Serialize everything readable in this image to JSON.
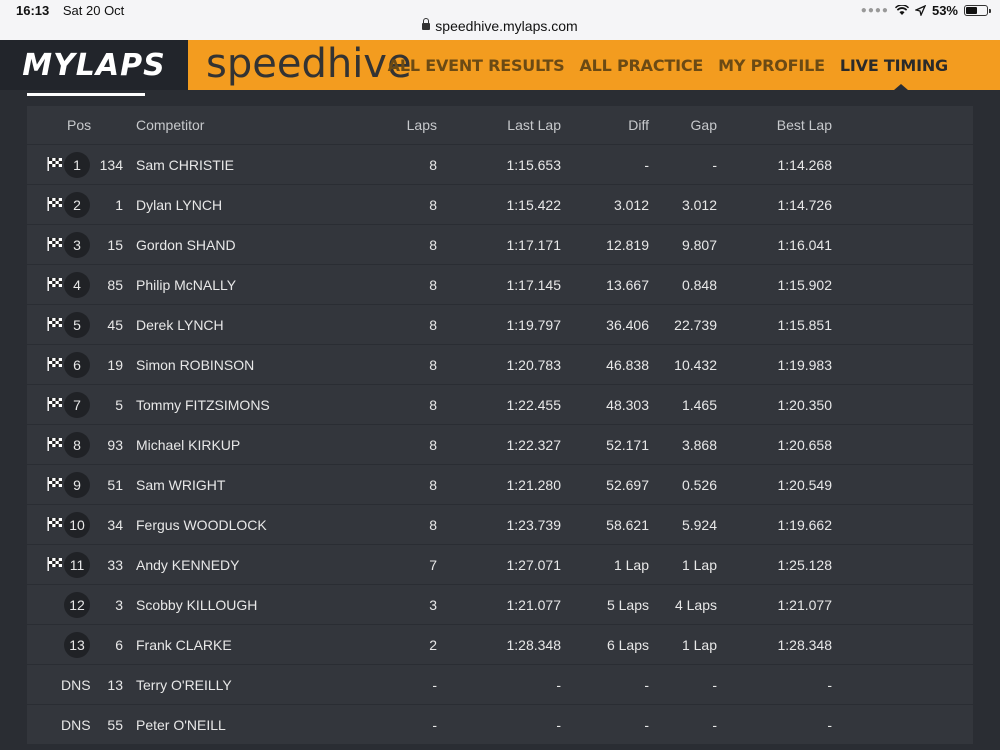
{
  "status": {
    "time": "16:13",
    "date": "Sat 20 Oct",
    "battery": "53%",
    "battery_level": 0.53
  },
  "browser": {
    "url": "speedhive.mylaps.com"
  },
  "header": {
    "logo": "MYLAPS",
    "brand": "speedhive",
    "nav": [
      "ALL EVENT RESULTS",
      "ALL PRACTICE",
      "MY PROFILE",
      "LIVE TIMING"
    ],
    "active_nav": "LIVE TIMING"
  },
  "table": {
    "columns": {
      "pos": "Pos",
      "competitor": "Competitor",
      "laps": "Laps",
      "last_lap": "Last Lap",
      "diff": "Diff",
      "gap": "Gap",
      "best_lap": "Best Lap"
    },
    "rows": [
      {
        "pos": "1",
        "num": "134",
        "name": "Sam CHRISTIE",
        "laps": "8",
        "last": "1:15.653",
        "diff": "-",
        "gap": "-",
        "best": "1:14.268",
        "flag": true
      },
      {
        "pos": "2",
        "num": "1",
        "name": "Dylan LYNCH",
        "laps": "8",
        "last": "1:15.422",
        "diff": "3.012",
        "gap": "3.012",
        "best": "1:14.726",
        "flag": true
      },
      {
        "pos": "3",
        "num": "15",
        "name": "Gordon SHAND",
        "laps": "8",
        "last": "1:17.171",
        "diff": "12.819",
        "gap": "9.807",
        "best": "1:16.041",
        "flag": true
      },
      {
        "pos": "4",
        "num": "85",
        "name": "Philip McNALLY",
        "laps": "8",
        "last": "1:17.145",
        "diff": "13.667",
        "gap": "0.848",
        "best": "1:15.902",
        "flag": true
      },
      {
        "pos": "5",
        "num": "45",
        "name": "Derek LYNCH",
        "laps": "8",
        "last": "1:19.797",
        "diff": "36.406",
        "gap": "22.739",
        "best": "1:15.851",
        "flag": true
      },
      {
        "pos": "6",
        "num": "19",
        "name": "Simon ROBINSON",
        "laps": "8",
        "last": "1:20.783",
        "diff": "46.838",
        "gap": "10.432",
        "best": "1:19.983",
        "flag": true
      },
      {
        "pos": "7",
        "num": "5",
        "name": "Tommy FITZSIMONS",
        "laps": "8",
        "last": "1:22.455",
        "diff": "48.303",
        "gap": "1.465",
        "best": "1:20.350",
        "flag": true
      },
      {
        "pos": "8",
        "num": "93",
        "name": "Michael KIRKUP",
        "laps": "8",
        "last": "1:22.327",
        "diff": "52.171",
        "gap": "3.868",
        "best": "1:20.658",
        "flag": true
      },
      {
        "pos": "9",
        "num": "51",
        "name": "Sam WRIGHT",
        "laps": "8",
        "last": "1:21.280",
        "diff": "52.697",
        "gap": "0.526",
        "best": "1:20.549",
        "flag": true
      },
      {
        "pos": "10",
        "num": "34",
        "name": "Fergus WOODLOCK",
        "laps": "8",
        "last": "1:23.739",
        "diff": "58.621",
        "gap": "5.924",
        "best": "1:19.662",
        "flag": true
      },
      {
        "pos": "11",
        "num": "33",
        "name": "Andy KENNEDY",
        "laps": "7",
        "last": "1:27.071",
        "diff": "1 Lap",
        "gap": "1 Lap",
        "best": "1:25.128",
        "flag": true
      },
      {
        "pos": "12",
        "num": "3",
        "name": "Scobby KILLOUGH",
        "laps": "3",
        "last": "1:21.077",
        "diff": "5 Laps",
        "gap": "4 Laps",
        "best": "1:21.077",
        "flag": false
      },
      {
        "pos": "13",
        "num": "6",
        "name": "Frank CLARKE",
        "laps": "2",
        "last": "1:28.348",
        "diff": "6 Laps",
        "gap": "1 Lap",
        "best": "1:28.348",
        "flag": false
      },
      {
        "pos": "DNS",
        "num": "13",
        "name": "Terry O'REILLY",
        "laps": "-",
        "last": "-",
        "diff": "-",
        "gap": "-",
        "best": "-",
        "flag": false
      },
      {
        "pos": "DNS",
        "num": "55",
        "name": "Peter O'NEILL",
        "laps": "-",
        "last": "-",
        "diff": "-",
        "gap": "-",
        "best": "-",
        "flag": false
      }
    ]
  }
}
